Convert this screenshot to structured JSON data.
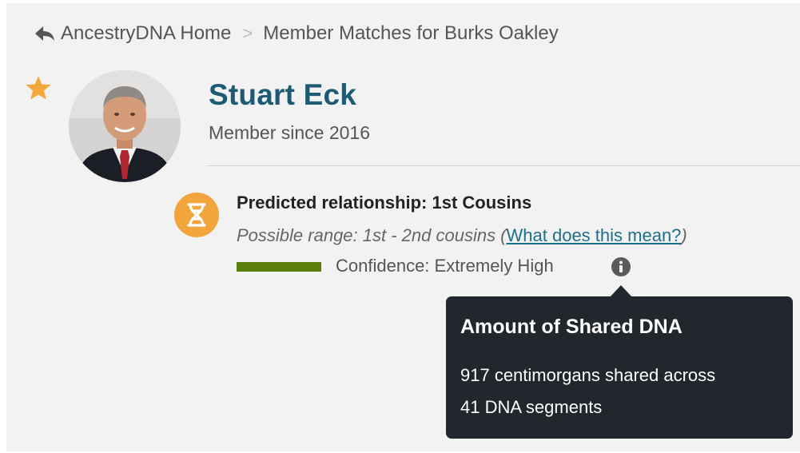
{
  "breadcrumb": {
    "back_icon": "reply-arrow-icon",
    "home_label": "AncestryDNA Home",
    "separator": ">",
    "current_label": "Member Matches for Burks Oakley"
  },
  "profile": {
    "star_icon": "star-icon",
    "star_color": "#f0a93a",
    "name": "Stuart Eck",
    "member_since": "Member since 2016"
  },
  "relationship": {
    "icon": "dna-icon",
    "icon_color": "#f3a53d",
    "predicted": "Predicted relationship: 1st Cousins",
    "range_prefix": "Possible range: 1st - 2nd cousins (",
    "range_link": "What does this mean?",
    "range_suffix": ")",
    "confidence_text": "Confidence: Extremely High",
    "confidence_color": "#5b7d09",
    "info_icon": "info-icon"
  },
  "tooltip": {
    "title": "Amount of Shared DNA",
    "line1": "917 centimorgans shared across",
    "line2": "41 DNA segments"
  }
}
